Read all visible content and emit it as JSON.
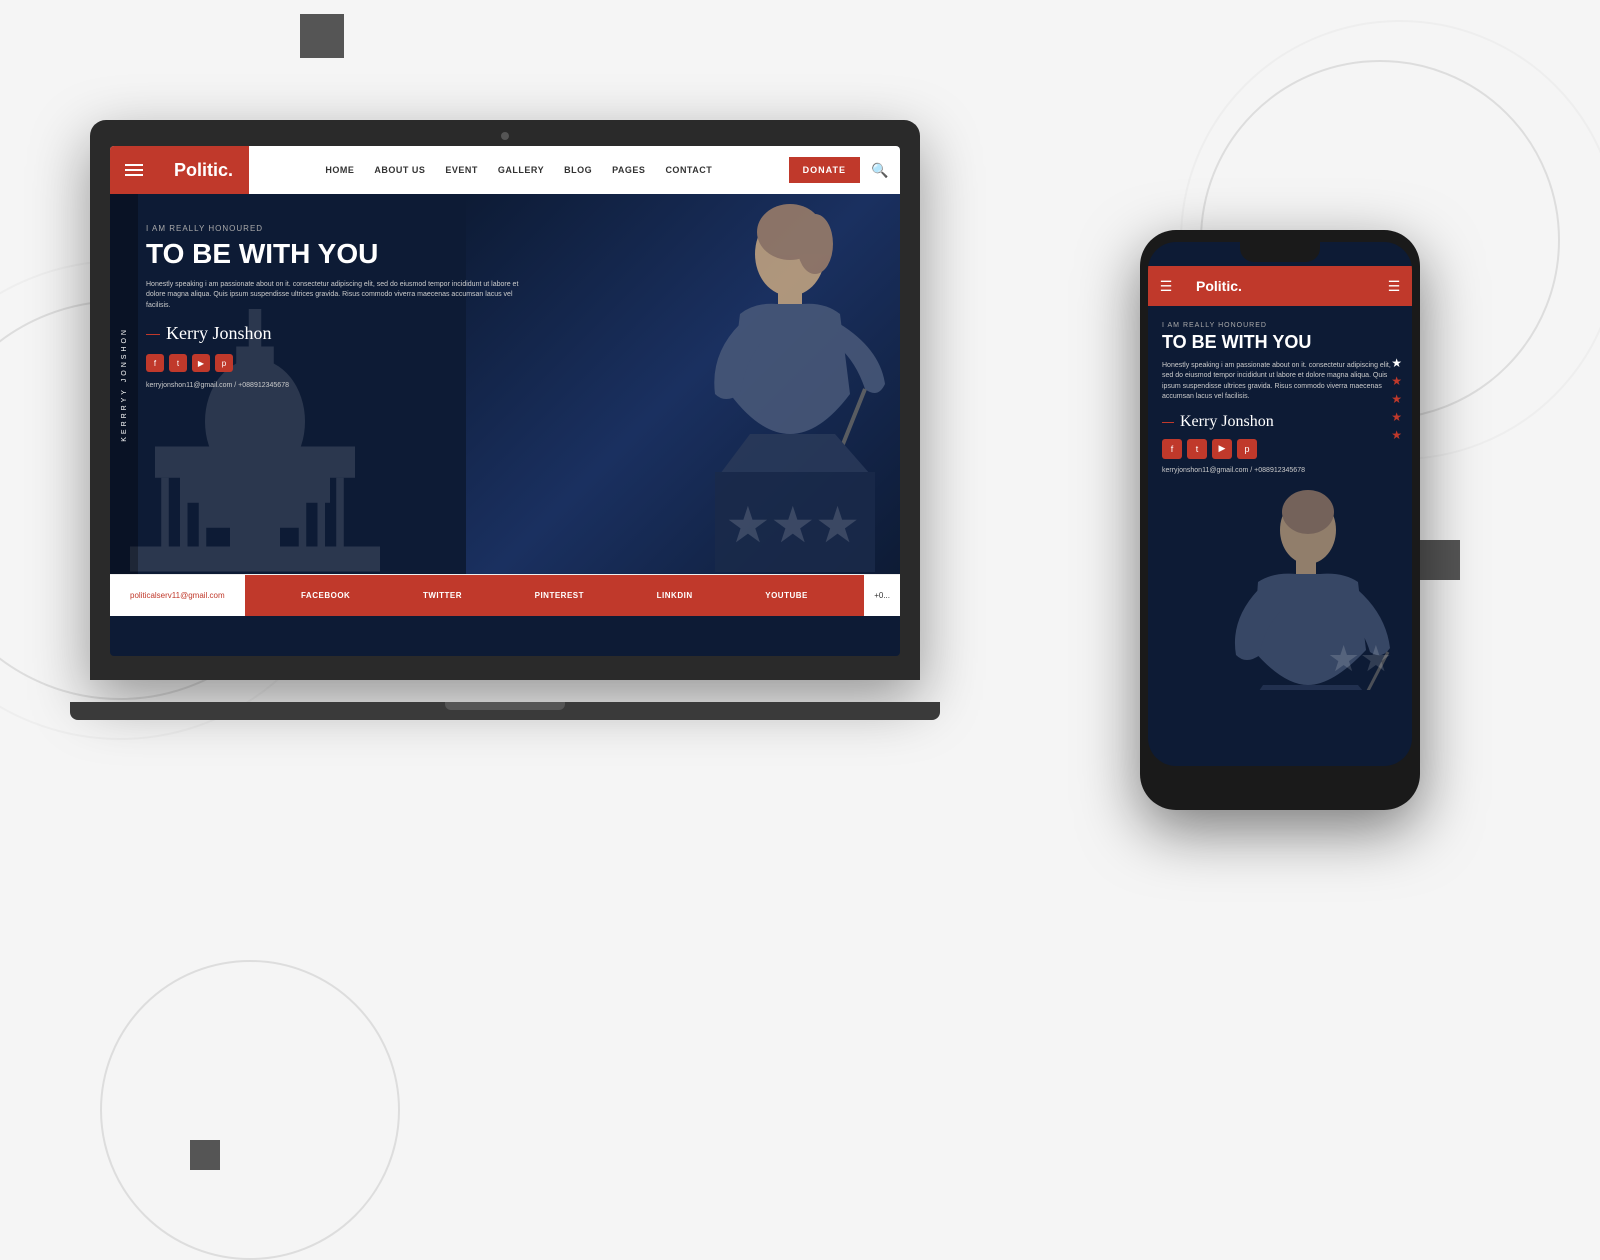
{
  "page": {
    "background_color": "#f5f5f5"
  },
  "laptop": {
    "site": {
      "header": {
        "logo": "Politic.",
        "donate_label": "DONATE",
        "nav_items": [
          "HOME",
          "ABOUT US",
          "EVENT",
          "GALLERY",
          "BLOG",
          "PAGES",
          "CONTACT"
        ]
      },
      "hero": {
        "side_text": "KERRRYY JONSHON",
        "subtitle": "I AM REALLY HONOURED",
        "title": "TO BE WITH YOU",
        "description": "Honestly speaking i am passionate about on it. consectetur adipiscing elit, sed do eiusmod tempor incididunt ut labore et dolore magna aliqua. Quis ipsum suspendisse ultrices gravida. Risus commodo viverra maecenas accumsan lacus vel facilisis.",
        "signature": "Kerry Jonshon",
        "contact_info": "kerryjonshon11@gmail.com / +088912345678",
        "social_icons": [
          "f",
          "t",
          "y",
          "p"
        ]
      },
      "footer": {
        "email": "politicalserv11@gmail.com",
        "social_links": [
          "FACEBOOK",
          "TWITTER",
          "PINTEREST",
          "LINKDIN",
          "YOUTUBE"
        ]
      }
    }
  },
  "phone": {
    "site": {
      "header": {
        "logo": "Politic.",
        "menu_icon": "☰",
        "right_menu_icon": "☰"
      },
      "hero": {
        "subtitle": "I AM REALLY HONOURED",
        "title": "TO BE WITH YOU",
        "description": "Honestly speaking i am passionate about on it. consectetur adipiscing elit, sed do eiusmod tempor incididunt ut labore et dolore magna aliqua. Quis ipsum suspendisse ultrices gravida. Risus commodo viverra maecenas accumsan lacus vel facilisis.",
        "signature": "Kerry Jonshon",
        "contact_info": "kerryjonshon11@gmail.com / +088912345678",
        "social_icons": [
          "f",
          "t",
          "y",
          "p"
        ],
        "stars": [
          "★",
          "★",
          "★",
          "★",
          "★"
        ]
      }
    }
  }
}
